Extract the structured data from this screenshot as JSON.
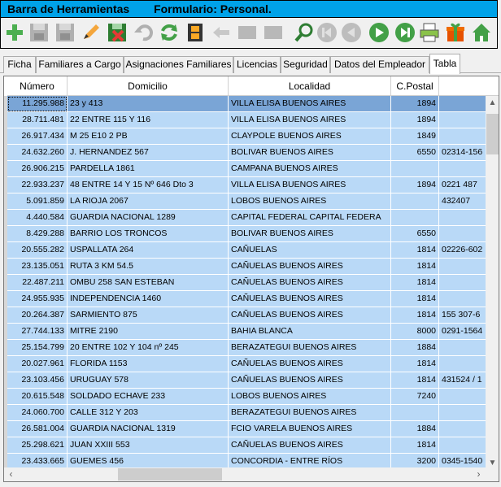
{
  "window": {
    "toolbar_title": "Barra de Herramientas",
    "form_title": "Formulario: Personal."
  },
  "toolbar": {
    "buttons": [
      {
        "icon": "add-icon",
        "enabled": true
      },
      {
        "icon": "save-icon",
        "enabled": false
      },
      {
        "icon": "save-as-icon",
        "enabled": false
      },
      {
        "icon": "edit-pencil-icon",
        "enabled": true
      },
      {
        "icon": "delete-icon",
        "enabled": true
      },
      {
        "icon": "undo-icon",
        "enabled": false
      },
      {
        "icon": "refresh-icon",
        "enabled": true
      },
      {
        "icon": "film-icon",
        "enabled": true
      },
      {
        "icon": "back-arrow-icon",
        "enabled": false
      },
      {
        "icon": "blank-icon",
        "enabled": false
      },
      {
        "icon": "blank2-icon",
        "enabled": false
      },
      {
        "icon": "search-icon",
        "enabled": true
      },
      {
        "icon": "first-record-icon",
        "enabled": false
      },
      {
        "icon": "previous-record-icon",
        "enabled": false
      },
      {
        "icon": "next-record-icon",
        "enabled": true
      },
      {
        "icon": "last-record-icon",
        "enabled": true
      },
      {
        "icon": "printer-icon",
        "enabled": true
      },
      {
        "icon": "gift-icon",
        "enabled": true
      },
      {
        "icon": "home-icon",
        "enabled": true
      }
    ]
  },
  "tabs": [
    {
      "label": "Ficha",
      "active": false
    },
    {
      "label": "Familiares a Cargo",
      "active": false
    },
    {
      "label": "Asignaciones Familiares",
      "active": false
    },
    {
      "label": "Licencias",
      "active": false
    },
    {
      "label": "Seguridad",
      "active": false
    },
    {
      "label": "Datos del Empleador",
      "active": false
    },
    {
      "label": "Tabla",
      "active": true
    }
  ],
  "table": {
    "columns": [
      "Número",
      "Domicilio",
      "Localidad",
      "C.Postal",
      ""
    ],
    "rows": [
      [
        "11.295.988",
        "23 y 413",
        "VILLA ELISA BUENOS AIRES",
        "1894",
        ""
      ],
      [
        "28.711.481",
        "22 ENTRE 115 Y 116",
        "VILLA ELISA BUENOS AIRES",
        "1894",
        ""
      ],
      [
        "26.917.434",
        "M 25 E10 2 PB",
        "CLAYPOLE BUENOS AIRES",
        "1849",
        ""
      ],
      [
        "24.632.260",
        "J. HERNANDEZ 567",
        "BOLIVAR BUENOS AIRES",
        "6550",
        "02314-156"
      ],
      [
        "26.906.215",
        "PARDELLA 1861",
        "CAMPANA BUENOS AIRES",
        "",
        ""
      ],
      [
        "22.933.237",
        "48 ENTRE 14 Y 15 Nº 646 Dto 3",
        "VILLA ELISA BUENOS AIRES",
        "1894",
        "0221  487"
      ],
      [
        "5.091.859",
        "LA RIOJA 2067",
        "LOBOS BUENOS AIRES",
        "",
        "432407"
      ],
      [
        "4.440.584",
        "GUARDIA NACIONAL 1289",
        "CAPITAL FEDERAL CAPITAL FEDERA",
        "",
        ""
      ],
      [
        "8.429.288",
        "BARRIO LOS TRONCOS",
        "BOLIVAR BUENOS AIRES",
        "6550",
        ""
      ],
      [
        "20.555.282",
        "USPALLATA 264",
        "CAÑUELAS",
        "1814",
        "02226-602"
      ],
      [
        "23.135.051",
        "RUTA 3 KM 54.5",
        "CAÑUELAS BUENOS AIRES",
        "1814",
        ""
      ],
      [
        "22.487.211",
        "OMBU 258 SAN ESTEBAN",
        "CAÑUELAS BUENOS AIRES",
        "1814",
        ""
      ],
      [
        "24.955.935",
        "INDEPENDENCIA 1460",
        "CAÑUELAS BUENOS AIRES",
        "1814",
        ""
      ],
      [
        "20.264.387",
        "SARMIENTO 875",
        "CAÑUELAS BUENOS AIRES",
        "1814",
        "155 307-6"
      ],
      [
        "27.744.133",
        "MITRE 2190",
        "BAHIA BLANCA",
        "8000",
        "0291-1564"
      ],
      [
        "25.154.799",
        "20 ENTRE 102 Y 104 nº 245",
        "BERAZATEGUI BUENOS AIRES",
        "1884",
        ""
      ],
      [
        "20.027.961",
        "FLORIDA 1153",
        "CAÑUELAS BUENOS AIRES",
        "1814",
        ""
      ],
      [
        "23.103.456",
        "URUGUAY 578",
        "CAÑUELAS BUENOS AIRES",
        "1814",
        "431524 / 1"
      ],
      [
        "20.615.548",
        "SOLDADO ECHAVE 233",
        "LOBOS BUENOS AIRES",
        "7240",
        ""
      ],
      [
        "24.060.700",
        "CALLE 312 Y 203",
        "BERAZATEGUI BUENOS AIRES",
        "",
        ""
      ],
      [
        "26.581.004",
        "GUARDIA NACIONAL 1319",
        "FCIO VARELA BUENOS AIRES",
        "1884",
        ""
      ],
      [
        "25.298.621",
        "JUAN XXIII 553",
        "CAÑUELAS BUENOS AIRES",
        "1814",
        ""
      ],
      [
        "23.433.665",
        "GUEMES 456",
        "CONCORDIA - ENTRE RÍOS",
        "3200",
        "0345-1540"
      ]
    ],
    "selected_row": 0
  },
  "colors": {
    "title_bar": "#00a2e8",
    "row_bg": "#b9d9f7",
    "row_selected": "#7aa5d6"
  }
}
